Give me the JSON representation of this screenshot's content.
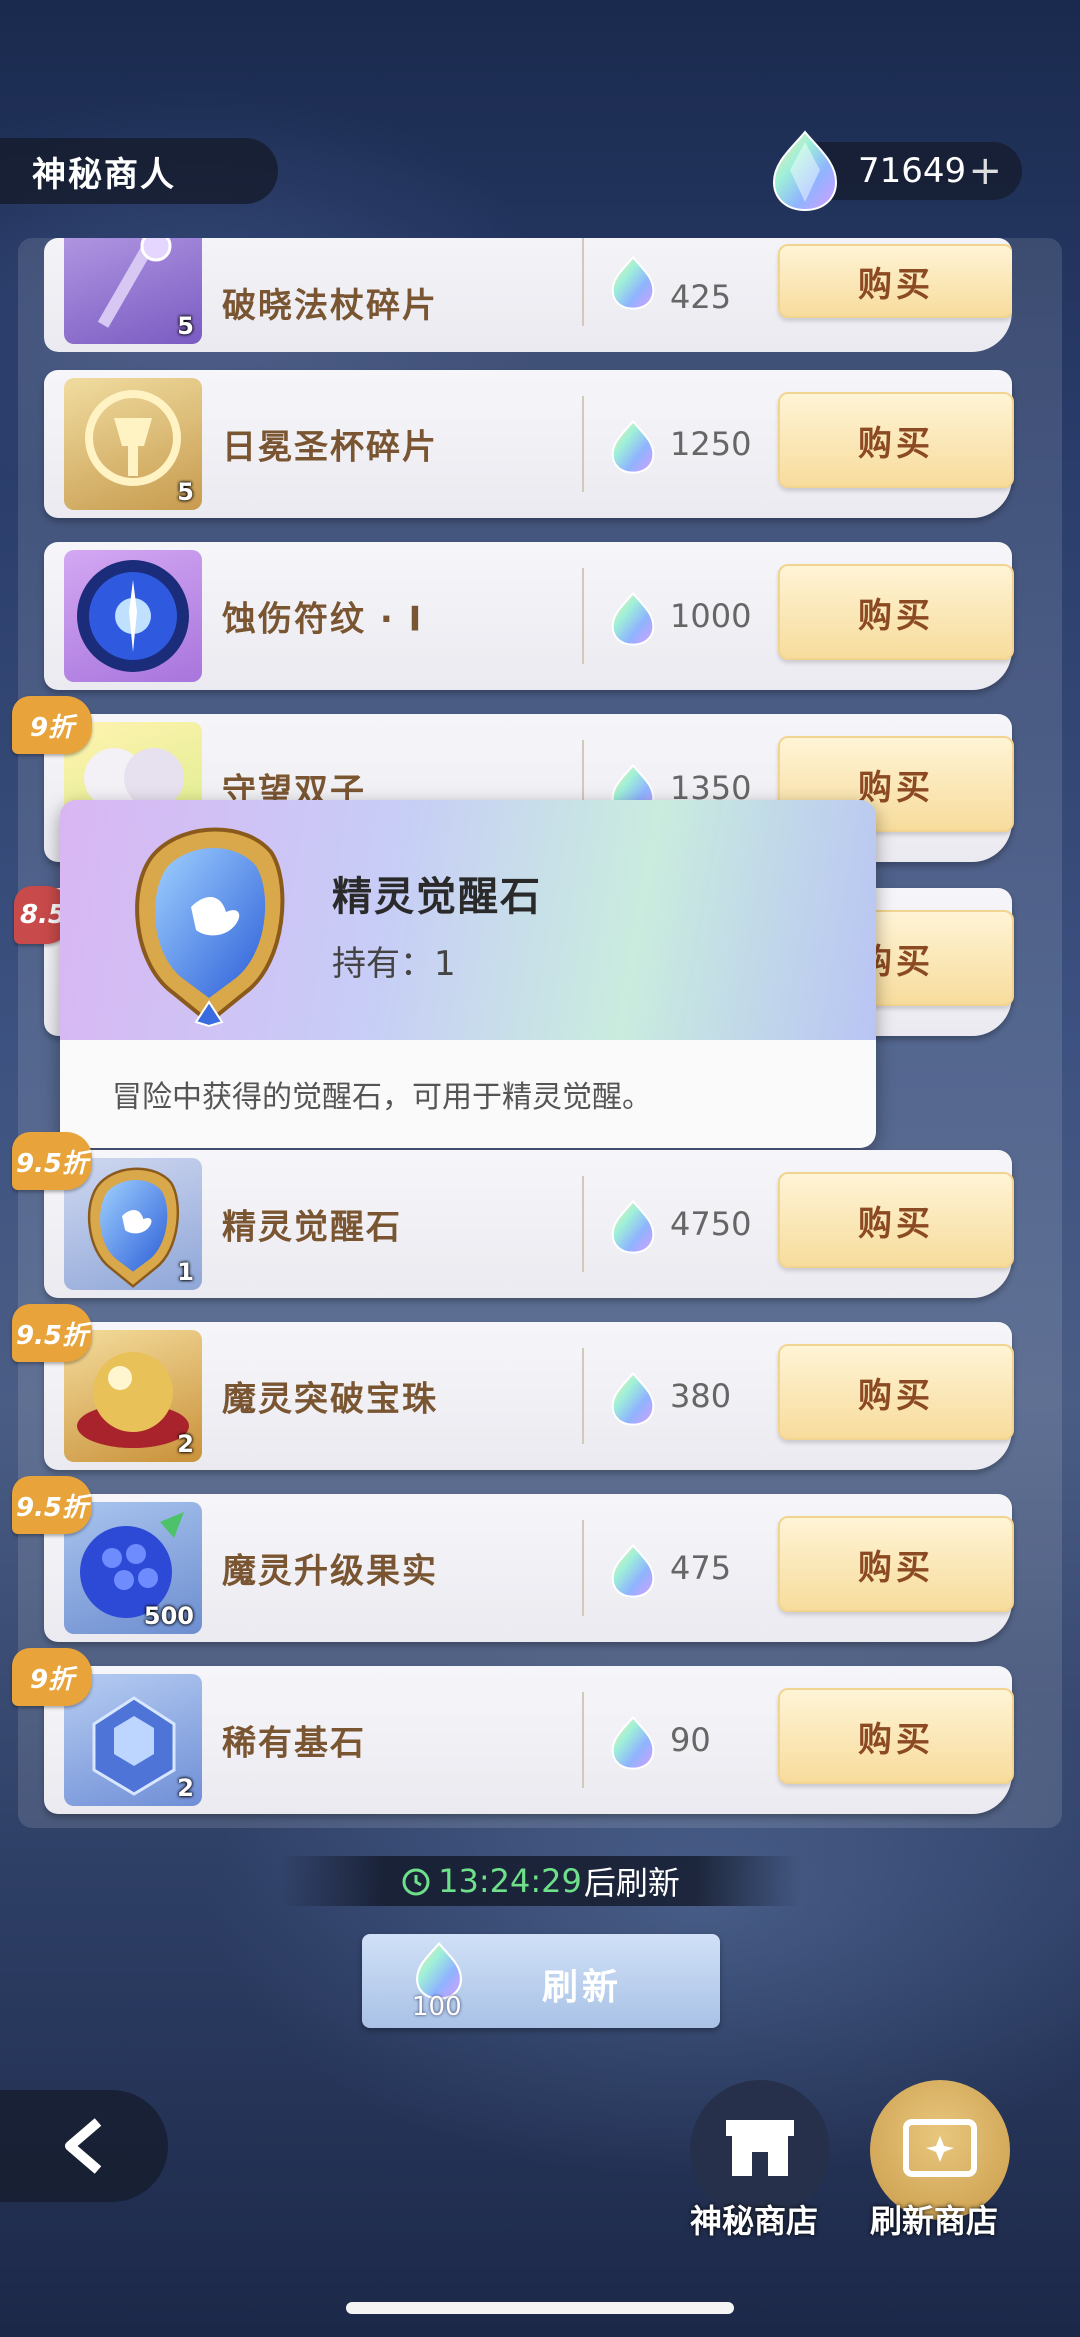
{
  "header": {
    "title": "神秘商人",
    "currency_amount": "71649",
    "plus": "+"
  },
  "items": [
    {
      "name": "破晓法杖碎片",
      "qty": "5",
      "price": "425",
      "buy": "购买",
      "discount": ""
    },
    {
      "name": "日冕圣杯碎片",
      "qty": "5",
      "price": "1250",
      "buy": "购买",
      "discount": ""
    },
    {
      "name": "蚀伤符纹 · I",
      "qty": "",
      "price": "1000",
      "buy": "购买",
      "discount": ""
    },
    {
      "name": "守望双子",
      "qty": "",
      "price": "1350",
      "buy": "购买",
      "discount": "9折"
    },
    {
      "name": "",
      "qty": "",
      "price": "",
      "buy": "购买",
      "discount": "8.5"
    },
    {
      "name": "精灵觉醒石",
      "qty": "1",
      "price": "4750",
      "buy": "购买",
      "discount": "9.5折"
    },
    {
      "name": "魔灵突破宝珠",
      "qty": "2",
      "price": "380",
      "buy": "购买",
      "discount": "9.5折"
    },
    {
      "name": "魔灵升级果实",
      "qty": "500",
      "price": "475",
      "buy": "购买",
      "discount": "9.5折"
    },
    {
      "name": "稀有基石",
      "qty": "2",
      "price": "90",
      "buy": "购买",
      "discount": "9折"
    }
  ],
  "tooltip": {
    "name": "精灵觉醒石",
    "owned": "持有：1",
    "description": "冒险中获得的觉醒石，可用于精灵觉醒。"
  },
  "refresh": {
    "timer": "13:24:29",
    "timer_suffix": "后刷新",
    "button_label": "刷新",
    "cost": "100"
  },
  "nav": {
    "mystery_shop": "神秘商店",
    "refresh_shop": "刷新商店"
  },
  "colors": {
    "accent_buy": "#f7dc9c",
    "item_name": "#7a5532",
    "timer_green": "#6fe08a",
    "discount_orange": "#e8a43a"
  }
}
